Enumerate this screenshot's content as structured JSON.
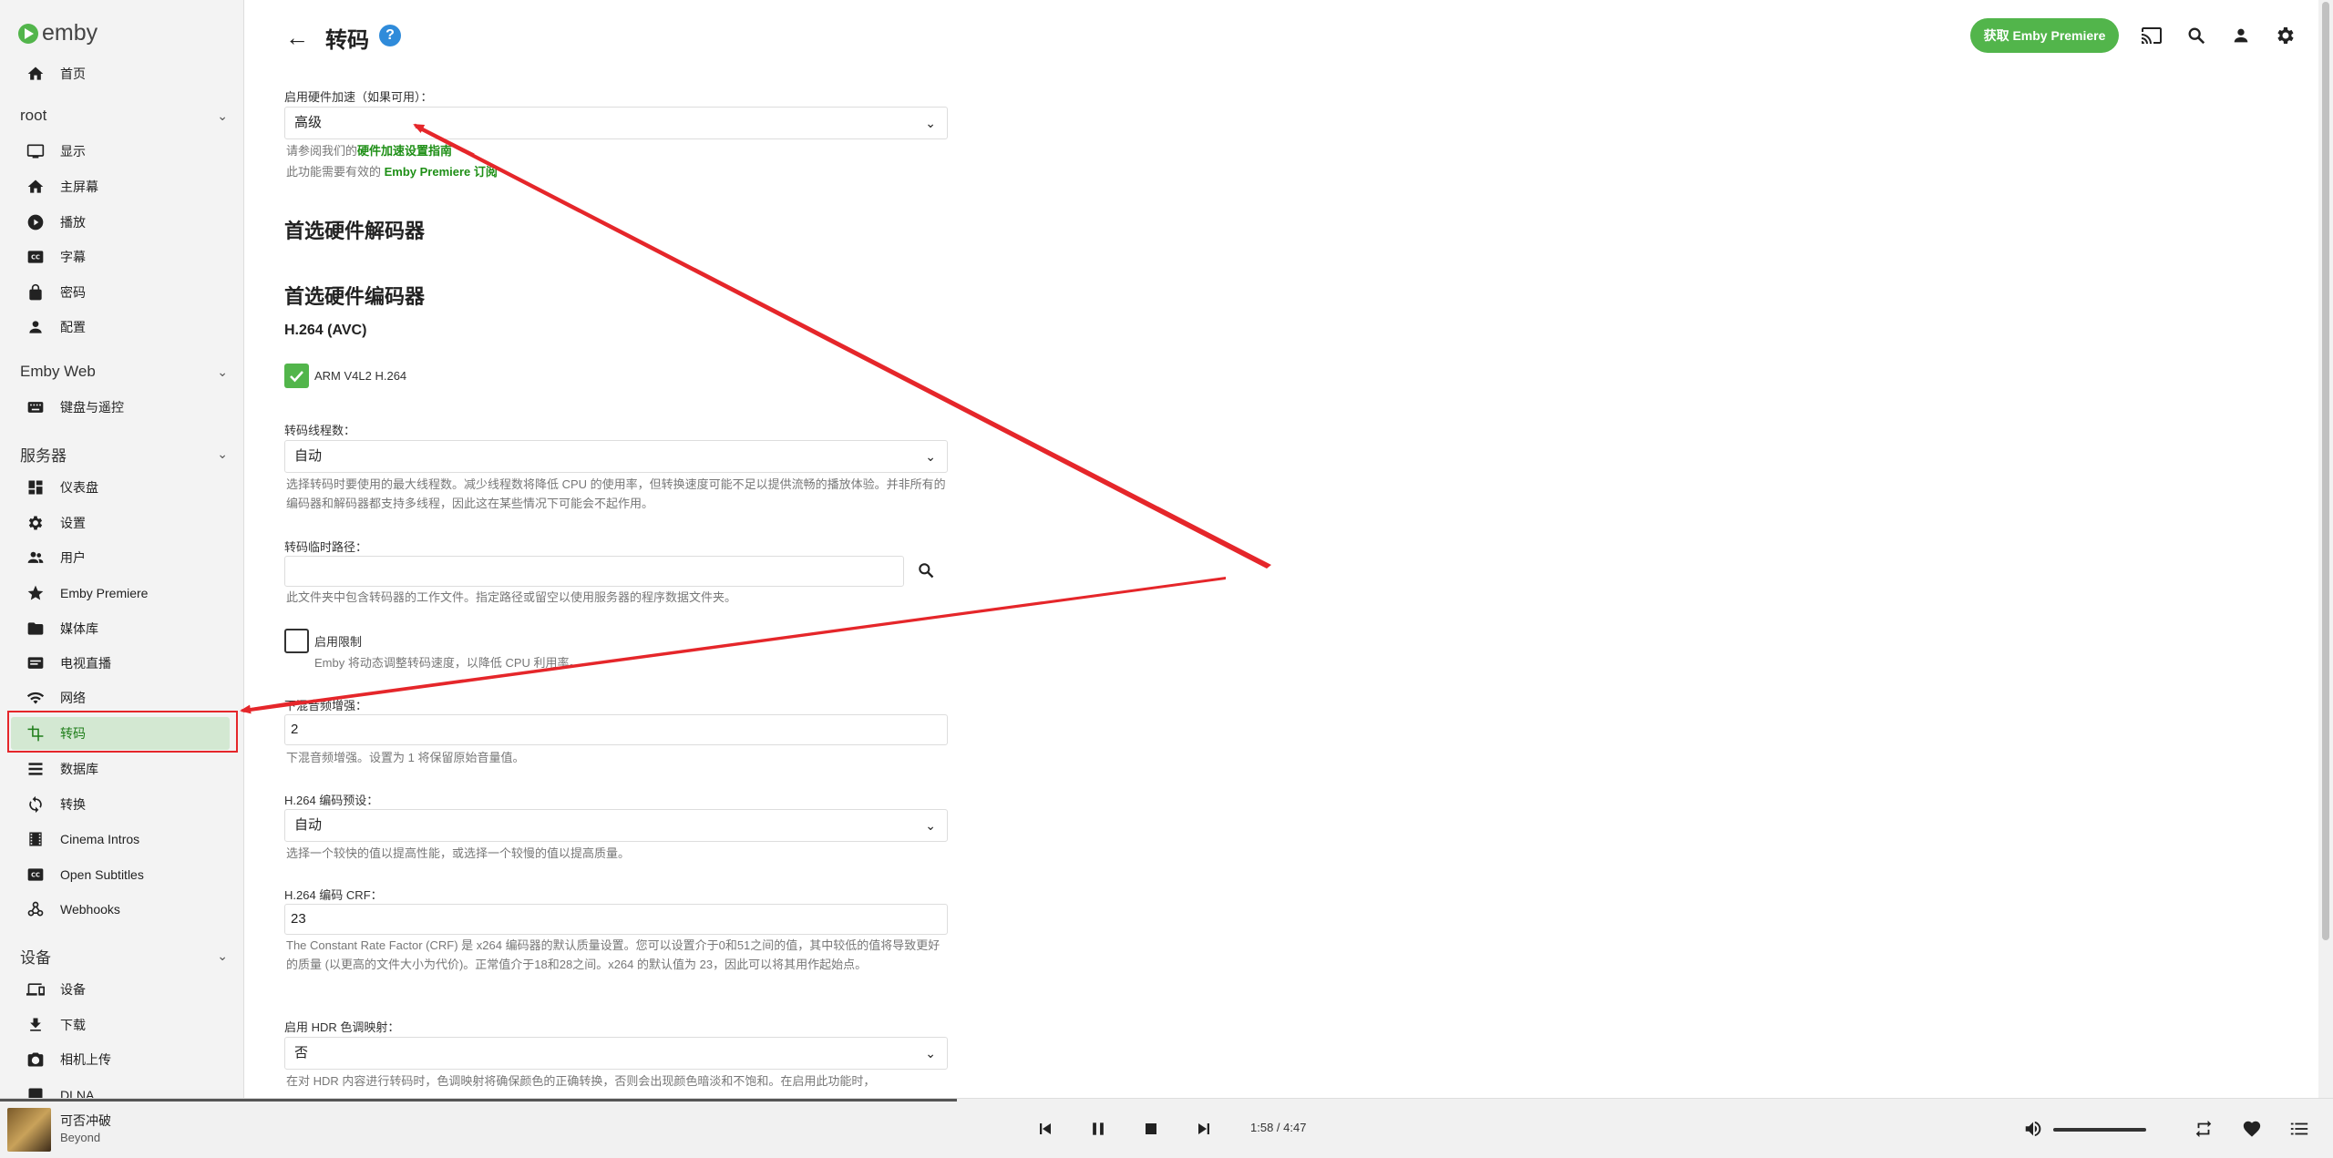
{
  "app": {
    "logo_text": "emby"
  },
  "sidebar": {
    "home": "首页",
    "sections": [
      {
        "title": "root",
        "items": [
          "显示",
          "主屏幕",
          "播放",
          "字幕",
          "密码",
          "配置"
        ]
      },
      {
        "title": "Emby Web",
        "items": [
          "键盘与遥控"
        ]
      },
      {
        "title": "服务器",
        "items": [
          "仪表盘",
          "设置",
          "用户",
          "Emby Premiere",
          "媒体库",
          "电视直播",
          "网络",
          "转码",
          "数据库",
          "转换",
          "Cinema Intros",
          "Open Subtitles",
          "Webhooks"
        ]
      },
      {
        "title": "设备",
        "items": [
          "设备",
          "下载",
          "相机上传",
          "DLNA"
        ]
      }
    ],
    "active_item": "转码"
  },
  "header": {
    "title": "转码",
    "help_label": "?",
    "premiere_button": "获取 Emby Premiere"
  },
  "form": {
    "hw_accel_label": "启用硬件加速（如果可用）：",
    "hw_accel_value": "高级",
    "hw_help_prefix": "请参阅我们的",
    "hw_help_link": "硬件加速设置指南",
    "hw_premiere_prefix": "此功能需要有效的 ",
    "hw_premiere_link": "Emby Premiere 订阅",
    "decoder_heading": "首选硬件解码器",
    "encoder_heading": "首选硬件编码器",
    "codec_heading": "H.264 (AVC)",
    "encoder_option": "ARM V4L2 H.264",
    "encoder_option_checked": true,
    "threads_label": "转码线程数：",
    "threads_value": "自动",
    "threads_help": "选择转码时要使用的最大线程数。减少线程数将降低 CPU 的使用率，但转换速度可能不足以提供流畅的播放体验。并非所有的编码器和解码器都支持多线程，因此这在某些情况下可能会不起作用。",
    "temp_path_label": "转码临时路径：",
    "temp_path_value": "",
    "temp_path_help": "此文件夹中包含转码器的工作文件。指定路径或留空以使用服务器的程序数据文件夹。",
    "throttle_label": "启用限制",
    "throttle_checked": false,
    "throttle_help": "Emby 将动态调整转码速度，以降低 CPU 利用率。",
    "downmix_label": "下混音频增强：",
    "downmix_value": "2",
    "downmix_help": "下混音频增强。设置为 1 将保留原始音量值。",
    "preset_label": "H.264 编码预设：",
    "preset_value": "自动",
    "preset_help": "选择一个较快的值以提高性能，或选择一个较慢的值以提高质量。",
    "crf_label": "H.264 编码 CRF：",
    "crf_value": "23",
    "crf_help": "The Constant Rate Factor (CRF) 是 x264 编码器的默认质量设置。您可以设置介于0和51之间的值，其中较低的值将导致更好的质量 (以更高的文件大小为代价)。正常值介于18和28之间。x264 的默认值为 23，因此可以将其用作起始点。",
    "hdr_label": "启用 HDR 色调映射：",
    "hdr_value": "否",
    "hdr_help": "在对 HDR 内容进行转码时，色调映射将确保颜色的正确转换，否则会出现颜色暗淡和不饱和。在启用此功能时，"
  },
  "player": {
    "song": "可否冲破",
    "artist": "Beyond",
    "time": "1:58 / 4:47",
    "progress_fraction": 0.41,
    "volume_fraction": 1.0
  },
  "colors": {
    "accent": "#52b54b",
    "annotation": "#e5262a",
    "help_blue": "#2f8bda"
  }
}
